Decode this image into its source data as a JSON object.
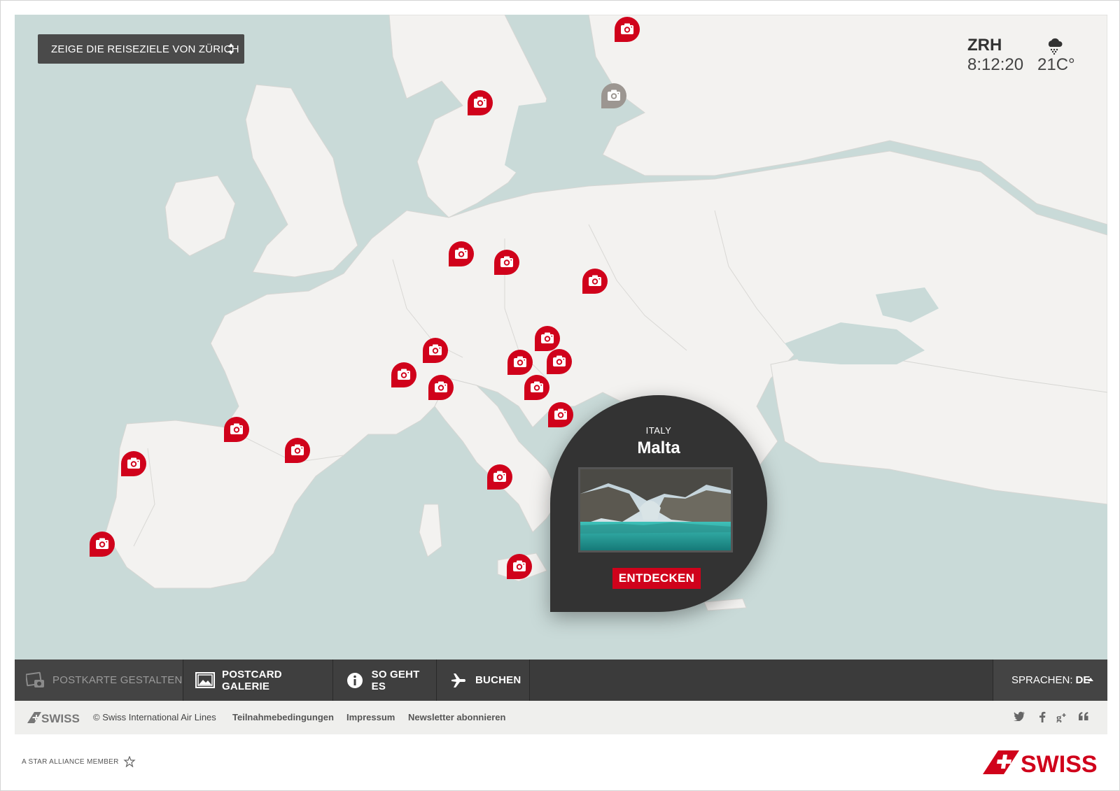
{
  "header": {
    "origin_select_label": "ZEIGE DIE REISEZIELE VON ZÜRICH"
  },
  "airport": {
    "code": "ZRH",
    "time": "8:12:20",
    "temperature": "21C°",
    "weather_icon": "snow-cloud-icon"
  },
  "popup": {
    "country": "ITALY",
    "city": "Malta",
    "cta_label": "ENTDECKEN"
  },
  "nav": {
    "items": [
      {
        "label": "POSTKARTE GESTALTEN",
        "icon": "postcard-create-icon"
      },
      {
        "label": "POSTCARD GALERIE",
        "icon": "gallery-icon"
      },
      {
        "label": "SO GEHT ES",
        "icon": "info-icon"
      },
      {
        "label": "BUCHEN",
        "icon": "plane-icon"
      }
    ],
    "language_label": "SPRACHEN:",
    "language_value": "DE"
  },
  "footer": {
    "logo_text": "SWISS",
    "copyright": "© Swiss International Air Lines",
    "links": [
      "Teilnahmebedingungen",
      "Impressum",
      "Newsletter abonnieren"
    ],
    "social_icons": [
      "twitter-icon",
      "facebook-icon",
      "google-plus-icon",
      "quote-icon"
    ]
  },
  "bottom": {
    "star_alliance": "A STAR ALLIANCE MEMBER",
    "brand_text": "SWISS"
  },
  "colors": {
    "accent": "#d0021b",
    "sea": "#c9dad8",
    "land": "#f3f2f0",
    "dark": "#333333",
    "inactive_pin": "#9c9691"
  }
}
